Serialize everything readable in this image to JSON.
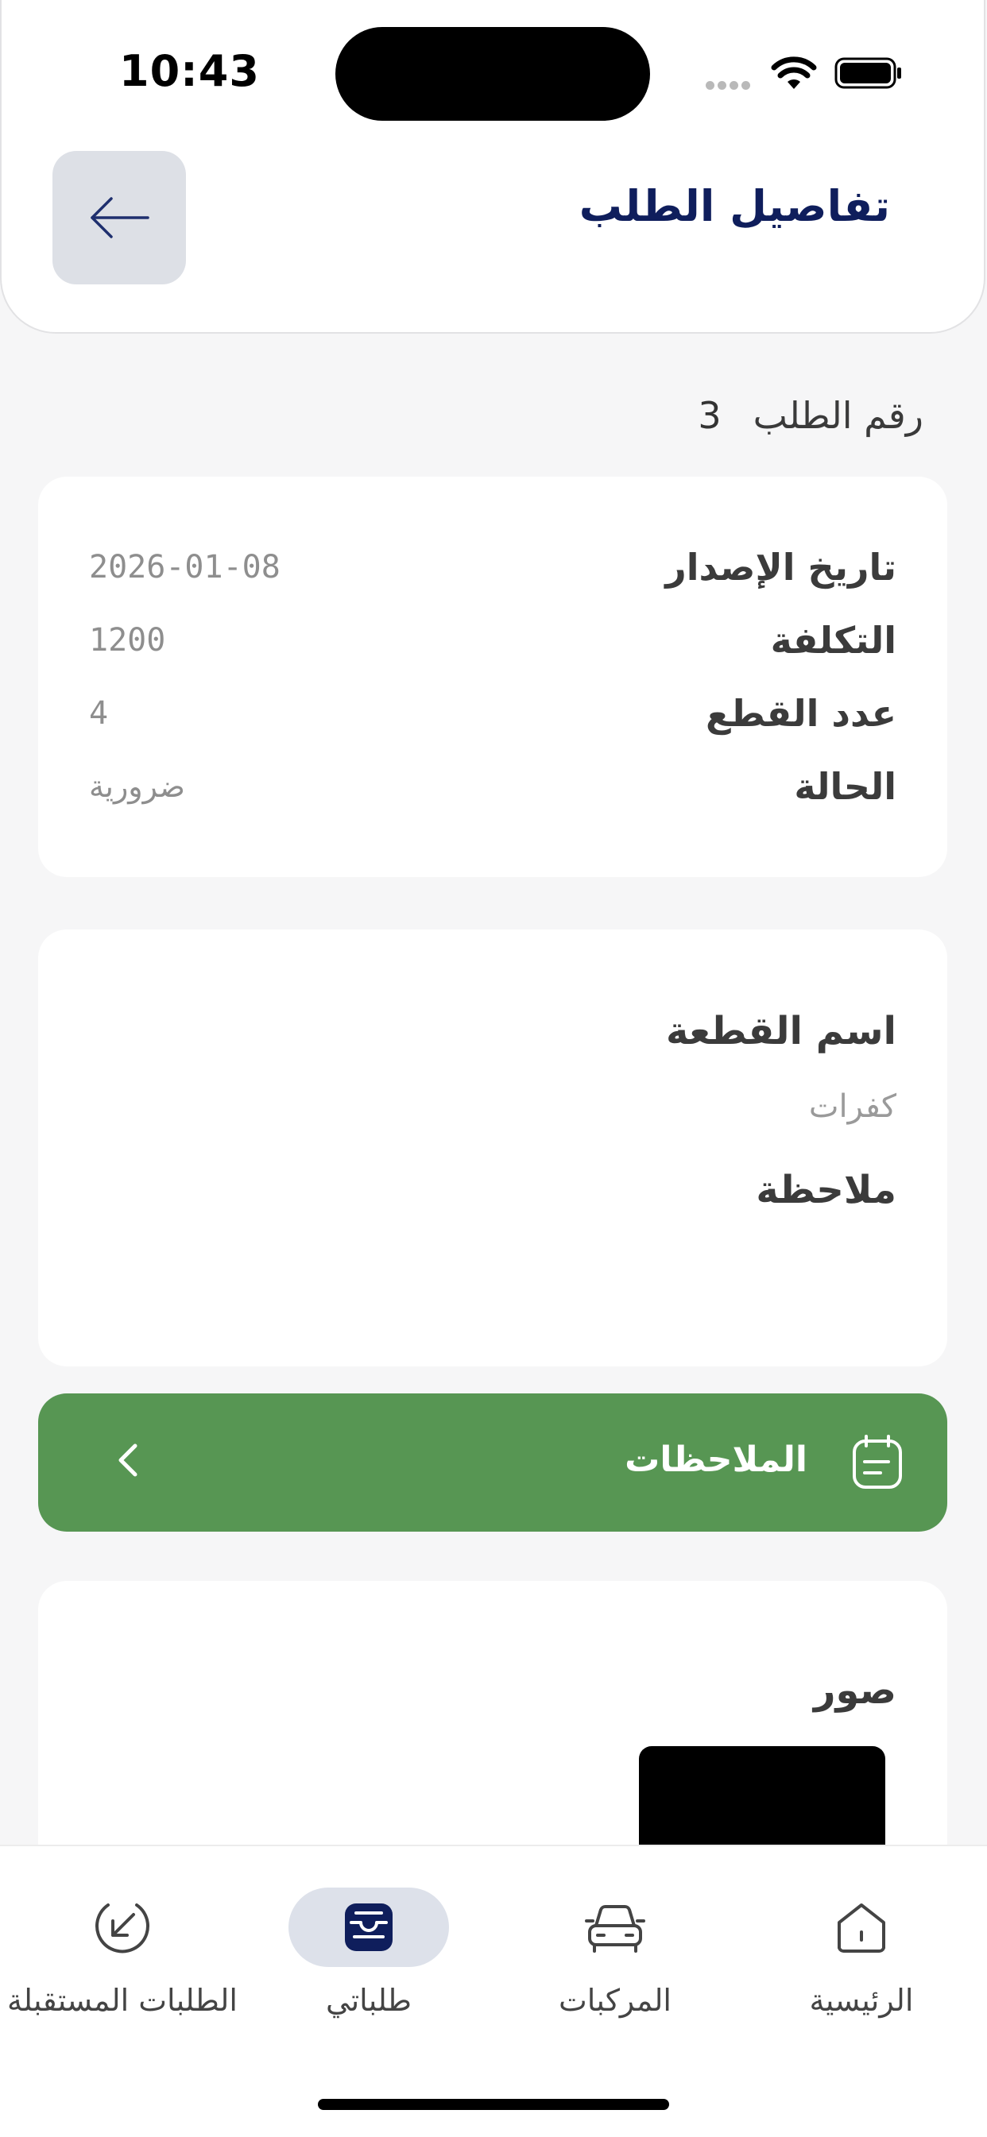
{
  "status_bar": {
    "time": "10:43"
  },
  "header": {
    "title": "تفاصيل الطلب"
  },
  "order": {
    "label": "رقم الطلب",
    "number": "3"
  },
  "info": [
    {
      "label": "تاريخ الإصدار",
      "value": "2026-01-08"
    },
    {
      "label": "التكلفة",
      "value": "1200"
    },
    {
      "label": "عدد القطع",
      "value": "4"
    },
    {
      "label": "الحالة",
      "value": "ضرورية"
    }
  ],
  "part": {
    "name_label": "اسم القطعة",
    "name_value": "كفرات",
    "note_label": "ملاحظة"
  },
  "notes_button": {
    "label": "الملاحظات",
    "color": "#579653"
  },
  "photos": {
    "title": "صور"
  },
  "nav": [
    {
      "label": "الرئيسية",
      "icon": "home-icon"
    },
    {
      "label": "المركبات",
      "icon": "car-icon"
    },
    {
      "label": "طلباتي",
      "icon": "inbox-icon",
      "active": true
    },
    {
      "label": "الطلبات المستقبلة",
      "icon": "incoming-arrow-icon"
    }
  ],
  "colors": {
    "primary": "#0f1e5c",
    "accent_green": "#579653"
  }
}
